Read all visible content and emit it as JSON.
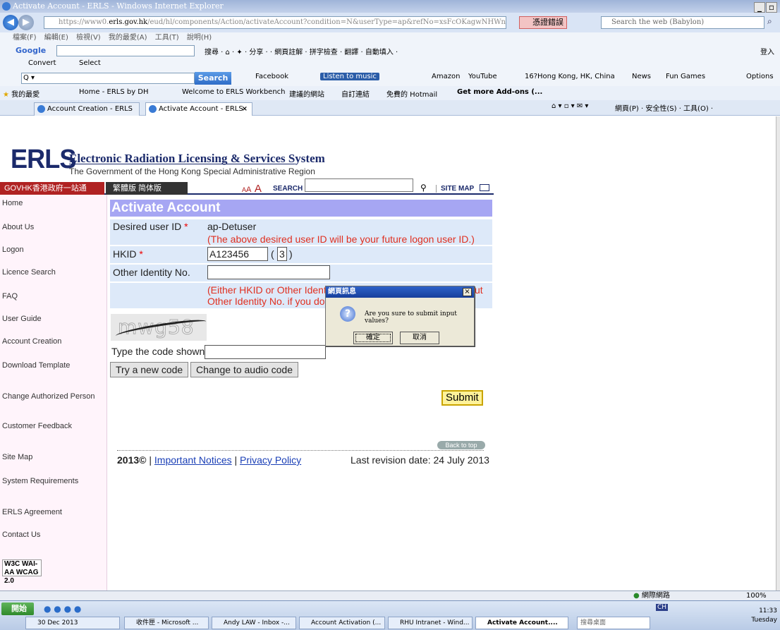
{
  "browser": {
    "title": "Activate Account - ERLS - Windows Internet Explorer",
    "url_prefix": "https://www0.",
    "url_domain": "erls.gov.hk",
    "url_rest": "/eud/hl/components/Action/activateAccount?condition=N&userType=ap&refNo=xsFcOKagwNHWn6X4gR0Bsw%3D%3D",
    "cert_error": "憑證錯誤",
    "web_search_placeholder": "Search the web (Babylon)",
    "menu": [
      "檔案(F)",
      "編輯(E)",
      "檢視(V)",
      "我的最愛(A)",
      "工具(T)",
      "說明(H)"
    ],
    "google_label": "Google",
    "google_tools": "搜尋 · ⌂ · ✦ ·  分享 ·  ·   網頁註解 ·  拼字檢查 ·  翻譯 ·  自動填入 ·",
    "login": "登入",
    "convert": "Convert",
    "select": "Select",
    "ask_search_button": "Search",
    "ask_links": [
      "Facebook",
      "Listen to music",
      "Amazon",
      "YouTube",
      "16?Hong Kong, HK, China",
      "News",
      "Fun Games"
    ],
    "options": "Options",
    "favorites_label": "我的最愛",
    "favorites": [
      "Home - ERLS by DH",
      "Welcome to ERLS Workbench",
      "建議的網站",
      "自訂連結",
      "免費的 Hotmail",
      "Get more Add-ons (..."
    ],
    "tabs": [
      "Account Creation - ERLS",
      "Activate Account - ERLS"
    ],
    "tab_close": "×",
    "command_tools": "網頁(P) ·  安全性(S) ·  工具(O) ·"
  },
  "site": {
    "logo": "ERLS",
    "title": "Electronic Radiation Licensing & Services System",
    "subtitle": "The Government of the Hong Kong Special Administrative Region",
    "govhk": "GOVHK香港政府一站通",
    "langs": "繁體版  简体版",
    "font_small": "A",
    "font_med": "A",
    "font_large": "A",
    "search_label": "SEARCH",
    "sitemap_label": "SITE MAP"
  },
  "nav": [
    "Home",
    "About Us",
    "Logon",
    "Licence Search",
    "FAQ",
    "User Guide",
    "Account Creation",
    "Download Template",
    "Change Authorized Person",
    "Customer Feedback",
    "Site Map",
    "System Requirements",
    "ERLS Agreement",
    "Contact Us"
  ],
  "w3c_badge": "W3C WAI-AA WCAG 2.0",
  "form": {
    "heading": "Activate Account",
    "userid_label": "Desired user ID",
    "required_mark": " *",
    "userid_value": "ap-Detuser",
    "userid_note": "(The above desired user ID will be your future logon user ID.)",
    "hkid_label": "HKID",
    "hkid_value": "A123456",
    "hkid_check": "3",
    "hkid_paren_open": "(",
    "hkid_paren_close": ")",
    "other_id_label": "Other Identity No.",
    "other_id_value": "",
    "either_note_1": "(Either HKID or Other Identity No. should be filled. Please input",
    "either_note_2": "Other Identity No. if you do not have HKID.)",
    "captcha_text": "mwg58",
    "code_label": "Type the code shown:",
    "code_value": "",
    "new_code_button": "Try a new code",
    "audio_code_button": "Change to audio code",
    "submit_button": "Submit",
    "back_to_top": "Back to top",
    "copyright": "2013©",
    "sep": " | ",
    "important_notices": "Important Notices",
    "privacy_policy": "Privacy Policy",
    "revision": "Last revision date: 24 July 2013"
  },
  "dialog": {
    "title": "網頁訊息",
    "close": "×",
    "icon": "?",
    "message": "Are you sure to submit input values?",
    "ok": "確定",
    "cancel": "取消"
  },
  "status": {
    "zone": "網際網路",
    "zoom": "100%"
  },
  "taskbar": {
    "start": "開始",
    "date_folder": "30 Dec 2013",
    "tasks": [
      "收件匣 - Microsoft ...",
      "Andy LAW - Inbox -...",
      "Account Activation (...",
      "RHU Intranet - Wind...",
      "Activate Account...."
    ],
    "desktop_search": "搜尋桌面",
    "lang": "CH",
    "time": "11:33",
    "day": "Tuesday"
  }
}
